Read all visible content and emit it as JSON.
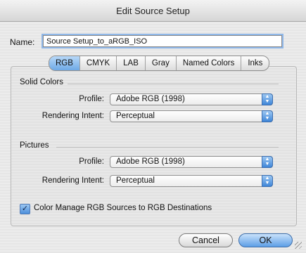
{
  "window": {
    "title": "Edit Source Setup"
  },
  "name_field": {
    "label": "Name:",
    "value": "Source Setup_to_aRGB_ISO"
  },
  "tabs": [
    {
      "label": "RGB",
      "active": true
    },
    {
      "label": "CMYK",
      "active": false
    },
    {
      "label": "LAB",
      "active": false
    },
    {
      "label": "Gray",
      "active": false
    },
    {
      "label": "Named Colors",
      "active": false
    },
    {
      "label": "Inks",
      "active": false
    }
  ],
  "solid_colors": {
    "heading": "Solid Colors",
    "profile_label": "Profile:",
    "profile_value": "Adobe RGB (1998)",
    "intent_label": "Rendering Intent:",
    "intent_value": "Perceptual"
  },
  "pictures": {
    "heading": "Pictures",
    "profile_label": "Profile:",
    "profile_value": "Adobe RGB (1998)",
    "intent_label": "Rendering Intent:",
    "intent_value": "Perceptual"
  },
  "checkbox": {
    "label": "Color Manage RGB Sources to RGB Destinations",
    "checked": true,
    "mark": "✓"
  },
  "buttons": {
    "cancel": "Cancel",
    "ok": "OK"
  },
  "icons": {
    "popup_arrows": "updown-arrows-icon",
    "up": "▲",
    "down": "▼"
  },
  "colors": {
    "accent": "#5d9ee6",
    "tab_active": "#6ea9e6"
  }
}
